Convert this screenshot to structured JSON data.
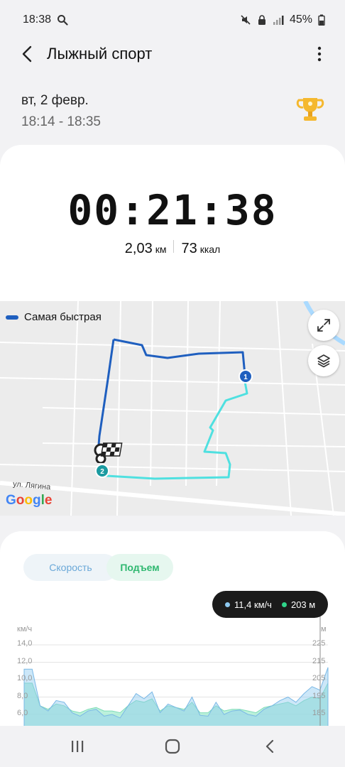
{
  "status_bar": {
    "time": "18:38",
    "battery": "45%",
    "icons": [
      "search-icon",
      "mute-icon",
      "lock-icon",
      "signal-icon",
      "battery-icon"
    ]
  },
  "app_bar": {
    "title": "Лыжный спорт",
    "back_icon": "back-arrow-icon",
    "more_icon": "more-vert-icon"
  },
  "workout": {
    "date": "вт, 2 февр.",
    "time_range": "18:14 - 18:35",
    "badge_icon": "trophy-icon",
    "duration": "00:21:38",
    "distance_value": "2,03",
    "distance_unit": "км",
    "calories_value": "73",
    "calories_unit": "ккал"
  },
  "map": {
    "legend_label": "Самая быстрая",
    "street_label": "ул. Лягина",
    "marker_1": "1",
    "marker_2": "2",
    "logo": [
      "G",
      "o",
      "o",
      "g",
      "l",
      "e"
    ],
    "expand_icon": "expand-icon",
    "layers_icon": "layers-icon",
    "fast_color": "#1f5fbf",
    "slow_color": "#4fe0e0"
  },
  "chart": {
    "tabs": {
      "speed": "Скорость",
      "climb": "Подъем"
    },
    "tooltip": {
      "speed": "11,4 км/ч",
      "altitude": "203 м"
    },
    "left_unit": "км/ч",
    "right_unit": "м",
    "left_ticks": [
      "14,0",
      "12,0",
      "10,0",
      "8,0",
      "6,0"
    ],
    "right_ticks": [
      "225",
      "215",
      "205",
      "195",
      "185"
    ],
    "speed_color": "#8ec9f0",
    "altitude_color": "#a6ecd0"
  },
  "chart_data": {
    "type": "area",
    "title": "",
    "series": [
      {
        "name": "Скорость",
        "unit": "км/ч",
        "values": [
          11.2,
          11.2,
          7.0,
          6.4,
          7.6,
          7.4,
          6.2,
          5.8,
          6.4,
          6.6,
          5.8,
          6.0,
          5.6,
          7.0,
          8.4,
          7.8,
          8.6,
          6.2,
          7.2,
          6.8,
          6.4,
          8.0,
          5.9,
          5.8,
          7.4,
          6.0,
          6.4,
          6.5,
          6.0,
          5.8,
          6.6,
          7.0,
          7.6,
          8.0,
          7.4,
          8.4,
          9.2,
          8.8,
          11.4
        ]
      },
      {
        "name": "Подъем",
        "unit": "м",
        "values": [
          203,
          203,
          190,
          188,
          191,
          190,
          187,
          186,
          188,
          189,
          187,
          187,
          186,
          190,
          193,
          192,
          194,
          187,
          190,
          189,
          188,
          192,
          186,
          186,
          190,
          187,
          188,
          188,
          187,
          186,
          189,
          190,
          191,
          192,
          190,
          193,
          195,
          194,
          203
        ]
      }
    ],
    "ylim_left": [
      6,
      14
    ],
    "ylim_right": [
      185,
      225
    ],
    "grid": true
  },
  "nav": {
    "recents_icon": "recents-icon",
    "home_icon": "home-icon",
    "back_icon": "nav-back-icon"
  }
}
